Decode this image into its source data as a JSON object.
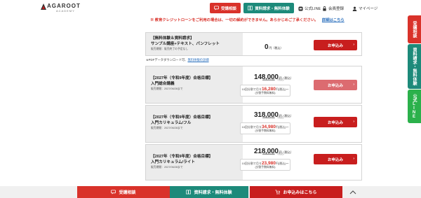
{
  "header": {
    "logo_text": "AGAROOT",
    "logo_sub": "ACADEMY",
    "consult_label": "受講相談",
    "docs_label": "資料請求・無料体験",
    "line_label": "公式LINE",
    "login_label": "会員登録",
    "mypage_label": "マイページ"
  },
  "notice": {
    "text": "※ 教育クレジットローンをご利用の場合は、一切の解約ができません。あらかじめご了承ください。",
    "link": "詳細はこちら"
  },
  "products": [
    {
      "title_line1": "【無料体験＆資料請求】",
      "title_line2": "サンプル講座+テキスト、パンフレット",
      "period": "販売期間：販売終了の予定なし",
      "price": "0",
      "yen": "円（税込）",
      "apply_label": "お申込み"
    },
    {
      "title_line1": "【2027年（令和9年度）合格目標】",
      "title_line2": "入門総合講義",
      "period": "販売期間：2027/06/28まで",
      "price": "148,000",
      "yen": "円（税込）",
      "original": "162,800円",
      "original_tax": "（税込）",
      "install_prefix": "10回分割で月々",
      "install_amount": "16,280",
      "install_suffix": "円(税込)〜",
      "install_note": "(分割手数料無料)",
      "apply_label": "お申込み"
    },
    {
      "title_line1": "【2027年（令和9年度）合格目標】",
      "title_line2": "入門カリキュラム/フル",
      "period": "販売期間：2027/06/28まで",
      "price": "318,000",
      "yen": "円（税込）",
      "original": "349,800円",
      "original_tax": "（税込）",
      "install_prefix": "10回分割で月々",
      "install_amount": "34,980",
      "install_suffix": "円(税込)〜",
      "install_note": "(分割手数料無料)",
      "apply_label": "お申込み"
    },
    {
      "title_line1": "【2027年（令和9年度）合格目標】",
      "title_line2": "入門カリキュラム/ライト",
      "period": "販売期間：2027/06/28まで",
      "price": "218,000",
      "yen": "円（税込）",
      "original": "239,800円",
      "original_tax": "（税込）",
      "install_prefix": "10回分割で月々",
      "install_amount": "23,980",
      "install_suffix": "円(税込)〜",
      "install_note": "(分割手数料無料)",
      "apply_label": "お申込み"
    }
  ],
  "pdf_note": {
    "text": "※PDFデータダウンロード可、",
    "link": "無料体験の詳細"
  },
  "side_tabs": {
    "consult": "受講相談",
    "docs": "資料請求・無料体験",
    "line": "公式LINE"
  },
  "bottom_bar": {
    "consult": "受講相談",
    "docs": "資料請求・無料体験",
    "apply": "お申込みはこちら"
  },
  "colors": {
    "red": "#d9322a",
    "apply_red": "#c81e1e",
    "teal": "#1d8a7a",
    "line_green": "#2bb14b"
  }
}
